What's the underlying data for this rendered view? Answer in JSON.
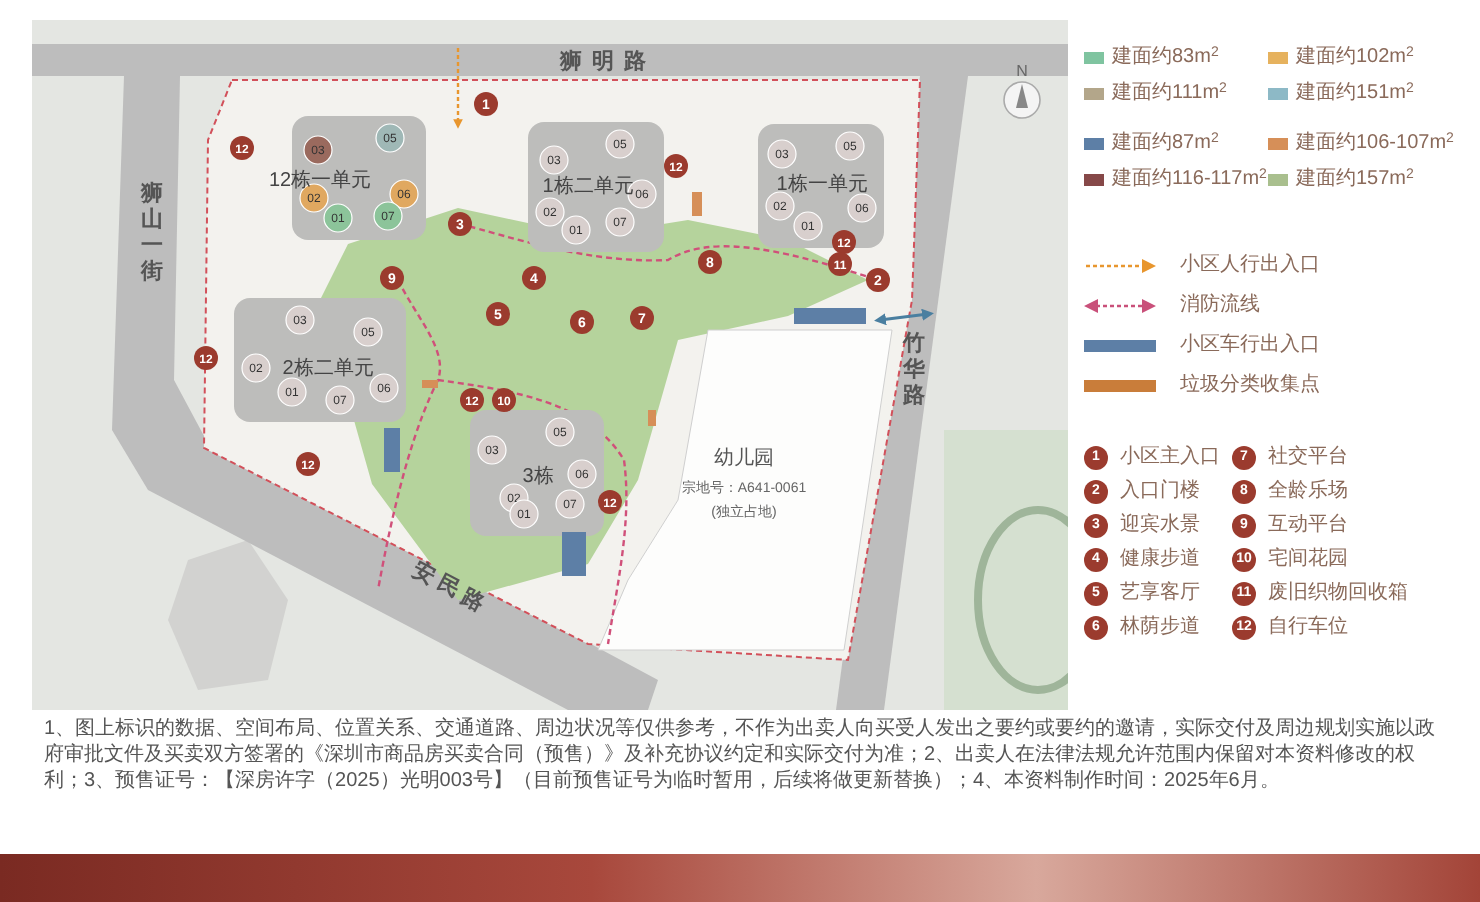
{
  "map": {
    "roads": [
      {
        "label": "狮明路"
      },
      {
        "label": "狮山一街"
      },
      {
        "label": "竹华路"
      },
      {
        "label": "安民路"
      }
    ],
    "compass": {
      "label": "N"
    },
    "buildings": [
      {
        "label": "12栋一单元",
        "units": [
          {
            "label": "03",
            "color": "#9a6a5e"
          },
          {
            "label": "05",
            "color": "#9fb8b6"
          },
          {
            "label": "02",
            "color": "#e0a860"
          },
          {
            "label": "06",
            "color": "#e0a860"
          },
          {
            "label": "01",
            "color": "#8cc49a"
          },
          {
            "label": "07",
            "color": "#8cc49a"
          }
        ]
      },
      {
        "label": "1栋二单元",
        "units": [
          {
            "label": "03",
            "color": "#d8cfcd"
          },
          {
            "label": "05",
            "color": "#d8cfcd"
          },
          {
            "label": "06",
            "color": "#d8cfcd"
          },
          {
            "label": "02",
            "color": "#d8cfcd"
          },
          {
            "label": "01",
            "color": "#d8cfcd"
          },
          {
            "label": "07",
            "color": "#d8cfcd"
          }
        ]
      },
      {
        "label": "1栋一单元",
        "units": [
          {
            "label": "03",
            "color": "#d8cfcd"
          },
          {
            "label": "05",
            "color": "#d8cfcd"
          },
          {
            "label": "06",
            "color": "#d8cfcd"
          },
          {
            "label": "02",
            "color": "#d8cfcd"
          },
          {
            "label": "01",
            "color": "#d8cfcd"
          }
        ]
      },
      {
        "label": "2栋二单元",
        "units": [
          {
            "label": "03",
            "color": "#d8cfcd"
          },
          {
            "label": "05",
            "color": "#d8cfcd"
          },
          {
            "label": "02",
            "color": "#d8cfcd"
          },
          {
            "label": "01",
            "color": "#d8cfcd"
          },
          {
            "label": "07",
            "color": "#d8cfcd"
          },
          {
            "label": "06",
            "color": "#d8cfcd"
          }
        ]
      },
      {
        "label": "3栋",
        "units": [
          {
            "label": "03",
            "color": "#d8cfcd"
          },
          {
            "label": "05",
            "color": "#d8cfcd"
          },
          {
            "label": "06",
            "color": "#d8cfcd"
          },
          {
            "label": "02",
            "color": "#d8cfcd"
          },
          {
            "label": "01",
            "color": "#d8cfcd"
          },
          {
            "label": "07",
            "color": "#d8cfcd"
          }
        ]
      }
    ],
    "markers": [
      {
        "label": "1"
      },
      {
        "label": "12"
      },
      {
        "label": "12"
      },
      {
        "label": "3"
      },
      {
        "label": "12"
      },
      {
        "label": "9"
      },
      {
        "label": "4"
      },
      {
        "label": "8"
      },
      {
        "label": "11"
      },
      {
        "label": "2"
      },
      {
        "label": "5"
      },
      {
        "label": "6"
      },
      {
        "label": "7"
      },
      {
        "label": "12"
      },
      {
        "label": "12"
      },
      {
        "label": "10"
      },
      {
        "label": "12"
      },
      {
        "label": "12"
      }
    ],
    "kindergarten": {
      "name": "幼儿园",
      "lot": "宗地号：A641-0061",
      "note": "(独立占地)"
    }
  },
  "legend": {
    "area_groups": [
      [
        {
          "label": "建面约83m$^{2}$",
          "color": "#7fc4a0"
        },
        {
          "label": "建面约102m$^{2}$",
          "color": "#e6b25e"
        },
        {
          "label": "建面约111m$^{2}$",
          "color": "#b3a68a"
        },
        {
          "label": "建面约151m$^{2}$",
          "color": "#8db9c6"
        }
      ],
      [
        {
          "label": "建面约87m$^{2}$",
          "color": "#5d7fa6"
        },
        {
          "label": "建面约106-107m$^{2}$",
          "color": "#d68f58"
        },
        {
          "label": "建面约116-117m$^{2}$",
          "color": "#864848"
        },
        {
          "label": "建面约157m$^{2}$",
          "color": "#a9bf8e"
        }
      ]
    ],
    "routes": [
      {
        "kind": "pedestrian",
        "label": "小区人行出入口"
      },
      {
        "kind": "fire",
        "label": "消防流线"
      },
      {
        "kind": "vehicle",
        "label": "小区车行出入口"
      },
      {
        "kind": "waste",
        "label": "垃圾分类收集点"
      }
    ],
    "facilities": [
      {
        "number": "1",
        "label": "小区主入口"
      },
      {
        "number": "2",
        "label": "入口门楼"
      },
      {
        "number": "3",
        "label": "迎宾水景"
      },
      {
        "number": "4",
        "label": "健康步道"
      },
      {
        "number": "5",
        "label": "艺享客厅"
      },
      {
        "number": "6",
        "label": "林荫步道"
      },
      {
        "number": "7",
        "label": "社交平台"
      },
      {
        "number": "8",
        "label": "全龄乐场"
      },
      {
        "number": "9",
        "label": "互动平台"
      },
      {
        "number": "10",
        "label": "宅间花园"
      },
      {
        "number": "11",
        "label": "废旧织物回收箱"
      },
      {
        "number": "12",
        "label": "自行车位"
      }
    ]
  },
  "footnote": "1、图上标识的数据、空间布局、位置关系、交通道路、周边状况等仅供参考，不作为出卖人向买受人发出之要约或要约的邀请，实际交付及周边规划实施以政府审批文件及买卖双方签署的《深圳市商品房买卖合同（预售）》及补充协议约定和实际交付为准；2、出卖人在法律法规允许范围内保留对本资料修改的权利；3、预售证号：【深房许字（2025）光明003号】（目前预售证号为临时暂用，后续将做更新替换）；4、本资料制作时间：2025年6月。"
}
